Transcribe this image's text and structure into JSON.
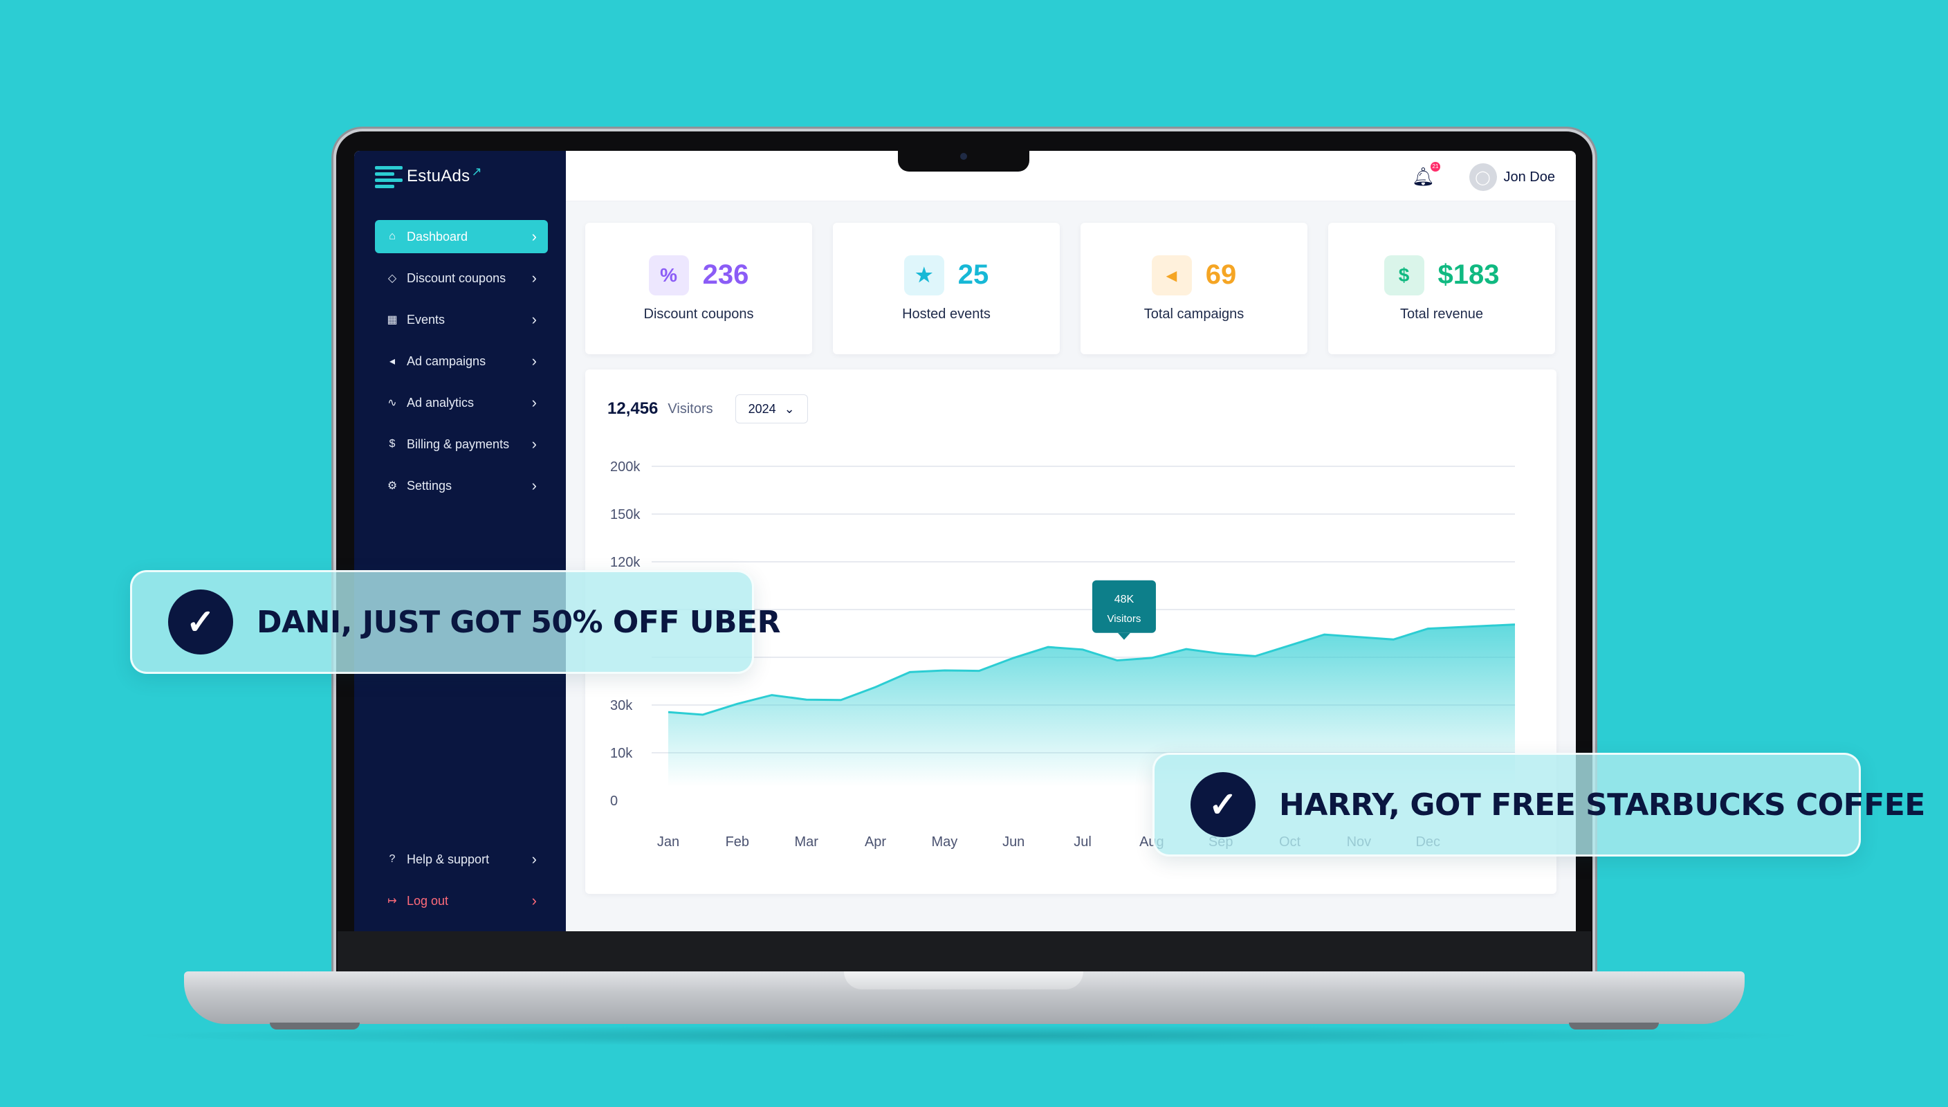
{
  "app": {
    "logo_text": "EstuAds"
  },
  "sidebar": {
    "items": [
      {
        "label": "Dashboard",
        "icon": "home-icon",
        "glyph": "⌂"
      },
      {
        "label": "Discount coupons",
        "icon": "tag-icon",
        "glyph": "◇"
      },
      {
        "label": "Events",
        "icon": "calendar-icon",
        "glyph": "▦"
      },
      {
        "label": "Ad campaigns",
        "icon": "megaphone-icon",
        "glyph": "◂"
      },
      {
        "label": "Ad analytics",
        "icon": "trend-icon",
        "glyph": "∿"
      },
      {
        "label": "Billing & payments",
        "icon": "dollar-icon",
        "glyph": "$"
      },
      {
        "label": "Settings",
        "icon": "gear-icon",
        "glyph": "⚙"
      }
    ],
    "bottom": [
      {
        "label": "Help & support",
        "icon": "help-icon",
        "glyph": "?"
      },
      {
        "label": "Log out",
        "icon": "logout-icon",
        "glyph": "↦"
      }
    ],
    "active_index": 0
  },
  "topbar": {
    "notification_count": "21",
    "user_name": "Jon Doe"
  },
  "stats": [
    {
      "value": "236",
      "label": "Discount coupons",
      "icon": "coupon-icon",
      "glyph": "%",
      "color": "#8b5cf6",
      "bg": "#ede7fe"
    },
    {
      "value": "25",
      "label": "Hosted events",
      "icon": "calendar-star-icon",
      "glyph": "★",
      "color": "#17b8d6",
      "bg": "#dff6fb"
    },
    {
      "value": "69",
      "label": "Total campaigns",
      "icon": "megaphone-icon",
      "glyph": "◂",
      "color": "#f5a524",
      "bg": "#fff1dc"
    },
    {
      "value": "$183",
      "label": "Total revenue",
      "icon": "dollar-circle-icon",
      "glyph": "$",
      "color": "#10b981",
      "bg": "#daf5ea"
    }
  ],
  "visitors": {
    "count": "12,456",
    "label": "Visitors",
    "year": "2024"
  },
  "chart_data": {
    "type": "area",
    "x": [
      "Jan",
      "Feb",
      "Mar",
      "Apr",
      "May",
      "Jun",
      "Jul",
      "Aug",
      "Sep",
      "Oct",
      "Nov",
      "Dec"
    ],
    "y_ticks": [
      "0",
      "10k",
      "30k",
      "",
      "",
      "120k",
      "150k",
      "200k"
    ],
    "y": [
      32,
      34,
      35,
      38,
      42,
      45,
      47,
      45,
      46,
      48,
      50,
      52
    ],
    "tooltip": {
      "month": "Aug",
      "value": "48K",
      "label": "Visitors"
    },
    "color": "#2ccdd3"
  },
  "notifications": [
    {
      "text": "DANI, JUST GOT 50% OFF UBER"
    },
    {
      "text": "HARRY, GOT FREE STARBUCKS COFFEE"
    }
  ]
}
